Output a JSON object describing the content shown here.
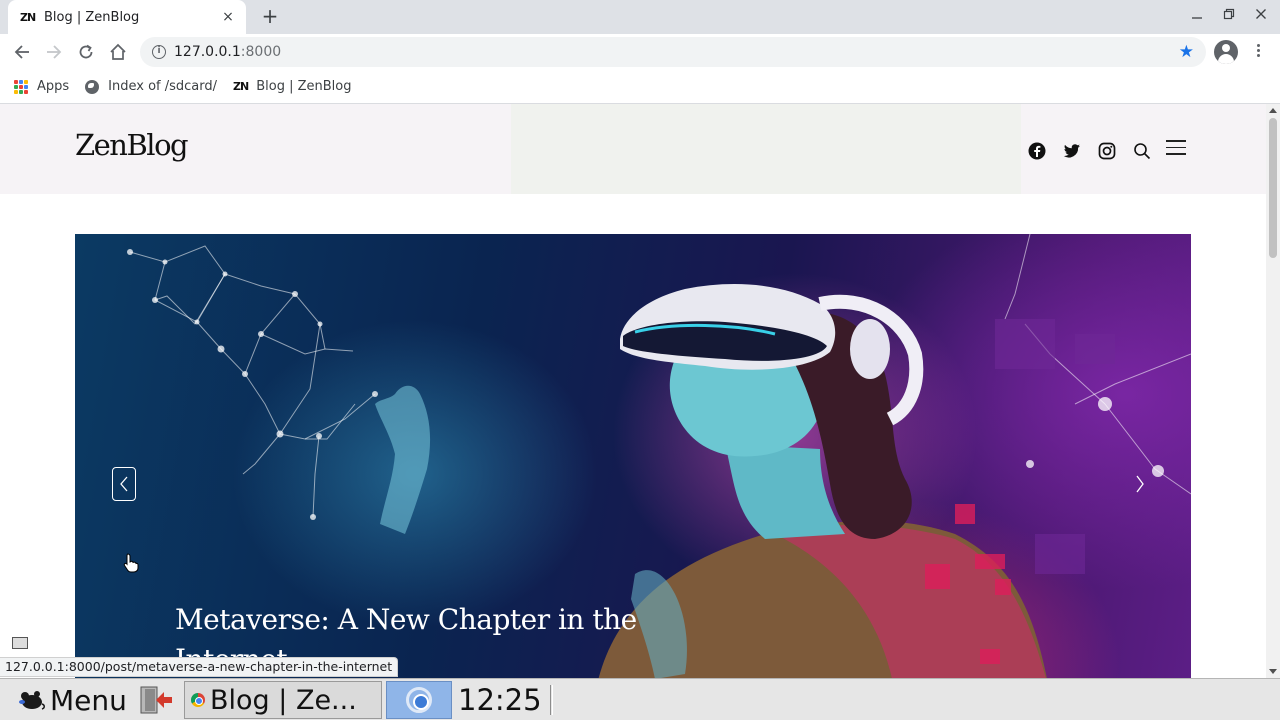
{
  "browser": {
    "tab": {
      "favicon": "ZN",
      "title": "Blog | ZenBlog",
      "close": "×"
    },
    "new_tab": "+",
    "window_controls": {
      "minimize": "—",
      "restore": "❐",
      "close": "✕"
    },
    "address": {
      "host": "127.0.0.1",
      "port": ":8000"
    },
    "bookmarks": [
      {
        "label": "Apps",
        "icon": "apps-grid-icon"
      },
      {
        "label": "Index of /sdcard/",
        "icon": "globe-icon"
      },
      {
        "label": "Blog | ZenBlog",
        "icon": "zenblog-favicon"
      }
    ],
    "status_url": "127.0.0.1:8000/post/metaverse-a-new-chapter-in-the-internet"
  },
  "site": {
    "logo": "ZenBlog",
    "social_icons": [
      "facebook-icon",
      "twitter-icon",
      "instagram-icon",
      "search-icon",
      "menu-icon"
    ],
    "hero": {
      "title": "Metaverse: A New Chapter in the Internet",
      "prev": "previous-slide",
      "next": "next-slide"
    }
  },
  "taskbar": {
    "menu_label": "Menu",
    "window_label": "Blog | Ze...",
    "clock": "12:25"
  },
  "colors": {
    "header_bg": "#f6f3f6",
    "ad_bg": "#f0f2ee",
    "star": "#1a73e8",
    "taskbar_bg": "#e6e6e6",
    "launcher_bg": "#8fb5e8"
  }
}
